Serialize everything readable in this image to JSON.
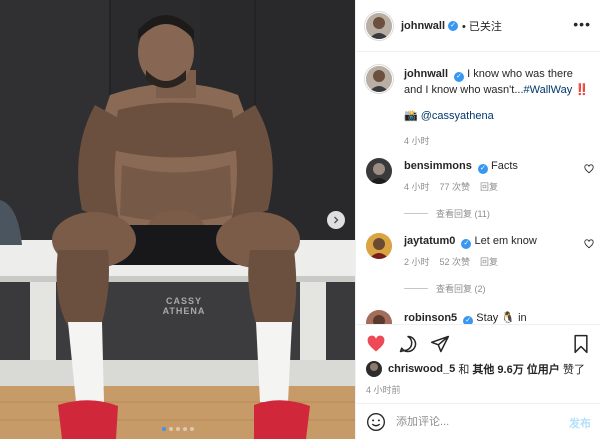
{
  "post": {
    "author": "johnwall",
    "follow_state": "• 已关注",
    "more_glyph": "•••",
    "caption_text": "I know who was there and I know who wasn't...",
    "caption_hashtag": "#WallWay",
    "caption_end": " ‼️",
    "credit_icon": "📸",
    "credit_handle": "@cassyathena",
    "caption_time": "4 小时",
    "watermark_line1": "CASSY",
    "watermark_line2": "ATHENA"
  },
  "comments": [
    {
      "user": "bensimmons",
      "text": "Facts",
      "time": "4 小时",
      "likes": "77 次赞",
      "reply": "回复",
      "view_replies": "查看回复 (11)"
    },
    {
      "user": "jaytatum0",
      "text": "Let em know",
      "time": "2 小时",
      "likes": "52 次赞",
      "reply": "回复",
      "view_replies": "查看回复 (2)"
    },
    {
      "user": "robinson5",
      "text": "Stay 🐧 in"
    }
  ],
  "actions": {
    "liked_by_user": "chriswood_5",
    "liked_by_connector": "和",
    "liked_by_others": "其他 9.6万 位用户",
    "liked_suffix": "赞了",
    "post_time": "4 小时前"
  },
  "composer": {
    "placeholder": "添加评论...",
    "post_label": "发布",
    "emoji_icon": "emoji-icon"
  },
  "carousel": {
    "slides": 5,
    "active_index": 0
  },
  "colors": {
    "accent": "#3897f0",
    "liked_red": "#ed4956",
    "link": "#00376b",
    "muted": "#8e8e8e"
  }
}
